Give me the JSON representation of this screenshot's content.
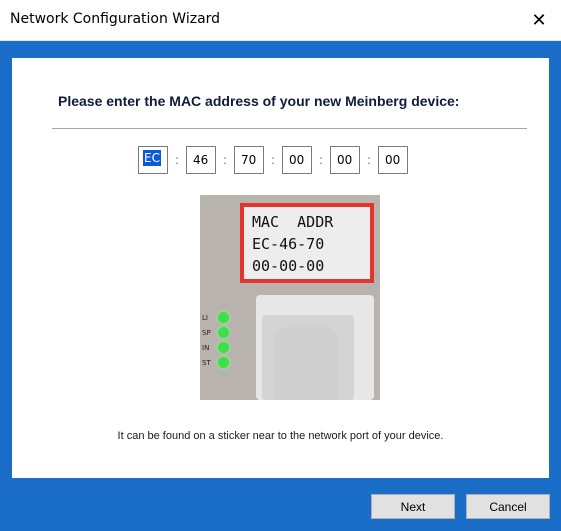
{
  "window": {
    "title": "Network Configuration Wizard",
    "close_glyph": "✕"
  },
  "heading": "Please enter the MAC address of your new Meinberg device:",
  "mac": {
    "octets": [
      "EC",
      "46",
      "70",
      "00",
      "00",
      "00"
    ],
    "separator": ":"
  },
  "photo": {
    "sticker_lines": [
      "MAC  ADDR",
      "EC-46-70",
      "00-00-00"
    ],
    "led_labels": [
      "LI",
      "SP",
      "IN",
      "ST"
    ]
  },
  "caption": "It can be found on a sticker near to the network port of your device.",
  "buttons": {
    "next": "Next",
    "cancel": "Cancel"
  },
  "colors": {
    "frame": "#1a6ec8",
    "selection": "#0b5ad9",
    "sticker_border": "#e3342f",
    "led": "#3ee04a"
  }
}
